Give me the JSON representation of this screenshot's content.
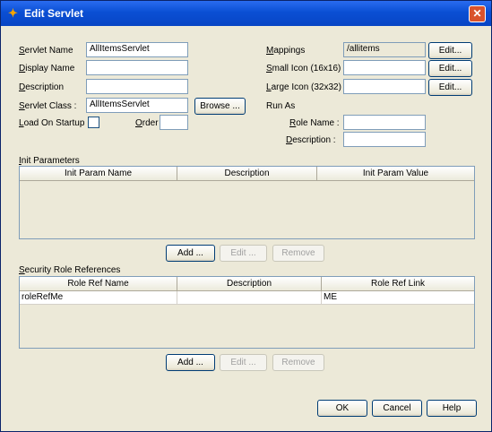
{
  "window": {
    "title": "Edit Servlet",
    "close_label": "✕"
  },
  "form": {
    "servlet_name_label": "Servlet Name",
    "servlet_name_value": "AllItemsServlet",
    "display_name_label": "Display Name",
    "display_name_value": "",
    "description_label": "Description",
    "description_value": "",
    "servlet_class_label": "Servlet Class :",
    "servlet_class_value": "AllItemsServlet",
    "browse_label": "Browse ...",
    "load_on_startup_label": "Load On Startup",
    "load_on_startup_checked": false,
    "order_label": "Order :",
    "order_value": "",
    "mappings_label": "Mappings",
    "mappings_value": "/allitems",
    "small_icon_label": "Small Icon (16x16)",
    "small_icon_value": "",
    "large_icon_label": "Large Icon (32x32)",
    "large_icon_value": "",
    "edit_label": "Edit...",
    "run_as_label": "Run As",
    "role_name_label": "Role Name :",
    "role_name_value": "",
    "run_as_description_label": "Description :",
    "run_as_description_value": ""
  },
  "init_params": {
    "title": "Init Parameters",
    "columns": [
      "Init Param Name",
      "Description",
      "Init Param Value"
    ],
    "rows": [],
    "add_label": "Add ...",
    "edit_label": "Edit ...",
    "remove_label": "Remove"
  },
  "security_roles": {
    "title": "Security Role References",
    "columns": [
      "Role Ref Name",
      "Description",
      "Role Ref Link"
    ],
    "rows": [
      [
        "roleRefMe",
        "",
        "ME"
      ]
    ],
    "add_label": "Add ...",
    "edit_label": "Edit ...",
    "remove_label": "Remove"
  },
  "footer": {
    "ok_label": "OK",
    "cancel_label": "Cancel",
    "help_label": "Help"
  },
  "colors": {
    "titlebar": "#0a4fd4",
    "dialog": "#ece9d8",
    "border": "#7f9db9"
  }
}
